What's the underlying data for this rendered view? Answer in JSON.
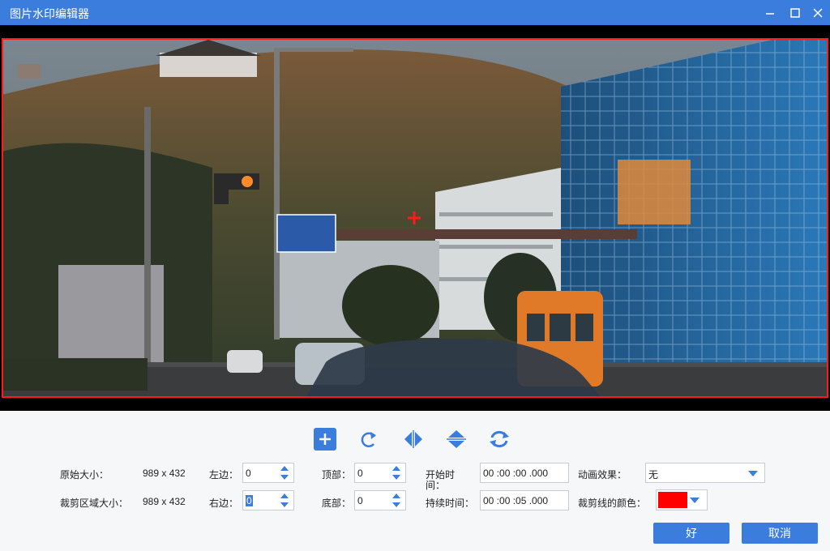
{
  "window": {
    "title": "图片水印编辑器",
    "controls": [
      "minimize-icon",
      "maximize-icon",
      "close-icon"
    ]
  },
  "toolbar": {
    "icons": [
      "add-icon",
      "rotate-icon",
      "flip-horizontal-icon",
      "flip-vertical-icon",
      "reset-icon"
    ]
  },
  "form": {
    "original_size_label": "原始大小：",
    "original_size_value": "989 x 432",
    "crop_size_label": "裁剪区域大小：",
    "crop_size_value": "989 x 432",
    "left_label": "左边：",
    "left_value": "0",
    "right_label": "右边：",
    "right_value": "0",
    "top_label": "顶部：",
    "top_value": "0",
    "bottom_label": "底部：",
    "bottom_value": "0",
    "start_time_label_1": "开始时",
    "start_time_label_2": "间：",
    "start_time_value": "00 :00 :00 .000",
    "duration_label": "持续时间：",
    "duration_value": "00 :00 :05 .000",
    "animation_label": "动画效果：",
    "animation_value": "无",
    "crop_color_label": "裁剪线的颜色：",
    "crop_color": "#ff0000"
  },
  "buttons": {
    "ok": "好",
    "cancel": "取消"
  },
  "colors": {
    "accent": "#3b7ddd",
    "crop_line": "#ff1a1a"
  }
}
